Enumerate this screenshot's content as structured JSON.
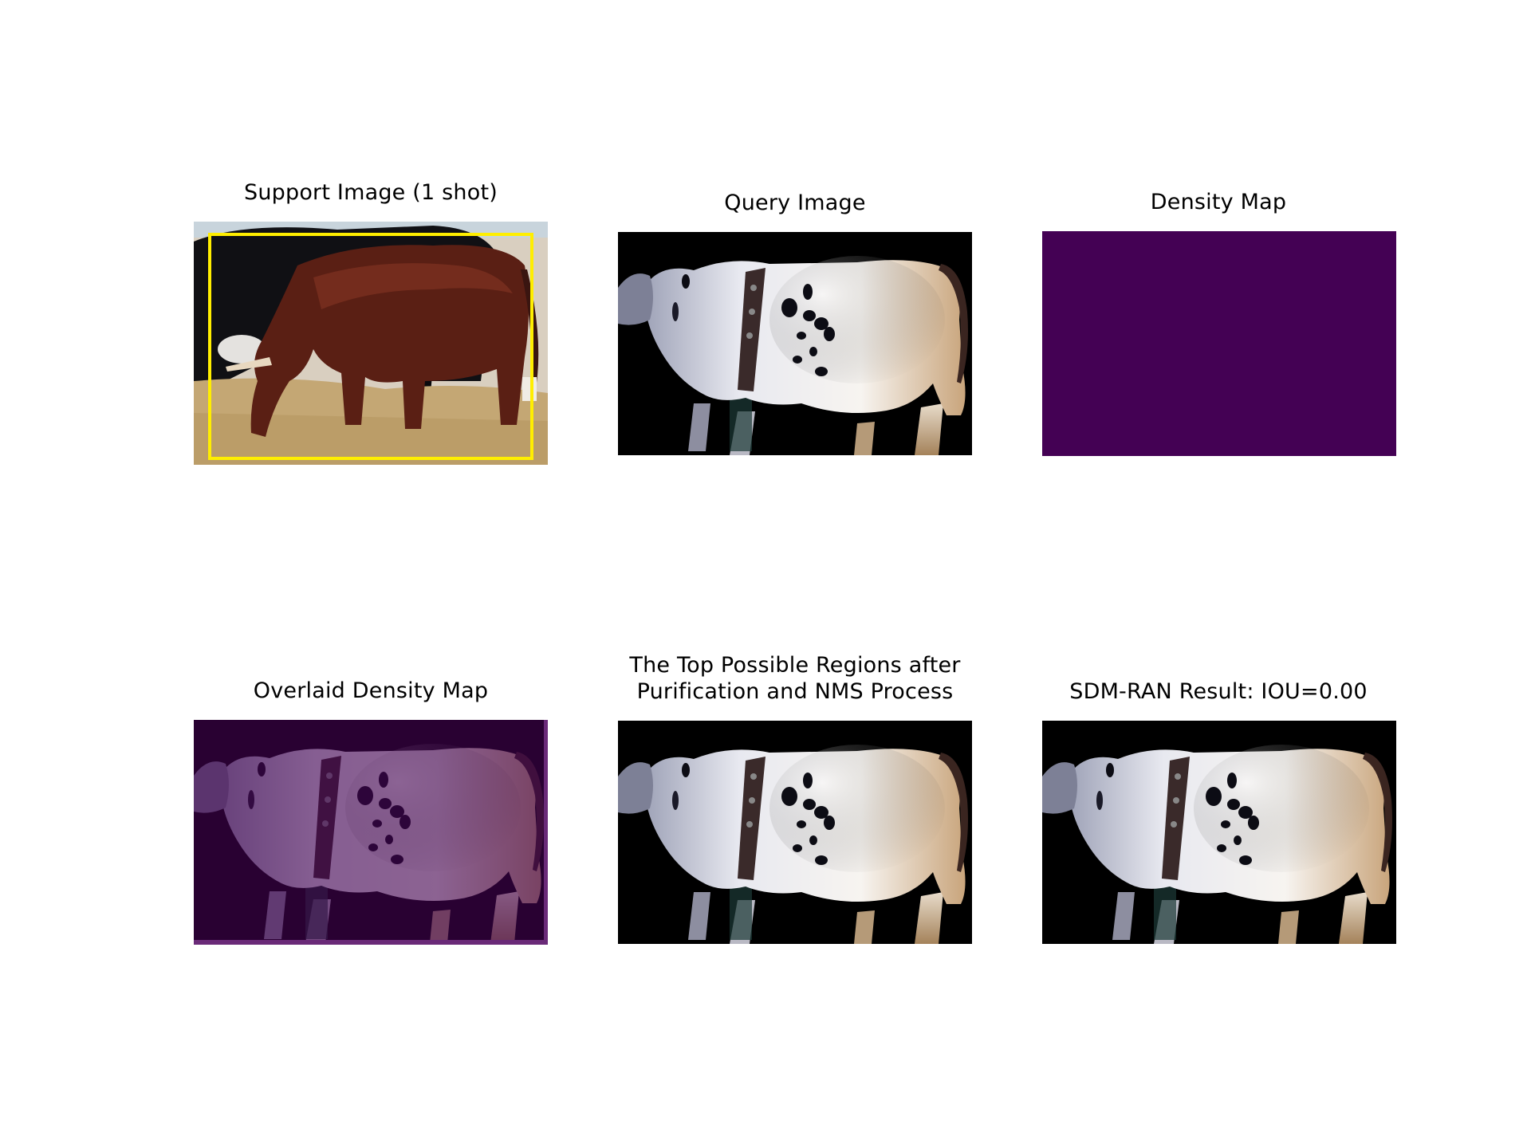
{
  "figure": {
    "panels": [
      {
        "id": "support",
        "title": "Support Image (1 shot)"
      },
      {
        "id": "query",
        "title": "Query Image"
      },
      {
        "id": "density",
        "title": "Density Map"
      },
      {
        "id": "overlaid",
        "title": "Overlaid Density Map"
      },
      {
        "id": "regions",
        "title": "The Top Possible Regions after\nPurification and NMS Process"
      },
      {
        "id": "result",
        "title": "SDM-RAN Result: IOU=0.00"
      }
    ]
  },
  "colors": {
    "density_fill": "#440154",
    "overlay_tint": "#2e0a3a",
    "support_bbox": "#ffee00",
    "query_background": "#000000"
  },
  "icons": {
    "support": "brown-cow-grazing-photo",
    "query": "white-spotted-cow-photo",
    "overlaid": "purple-tinted-cow-photo",
    "regions": "white-spotted-cow-photo",
    "result": "white-spotted-cow-photo"
  }
}
